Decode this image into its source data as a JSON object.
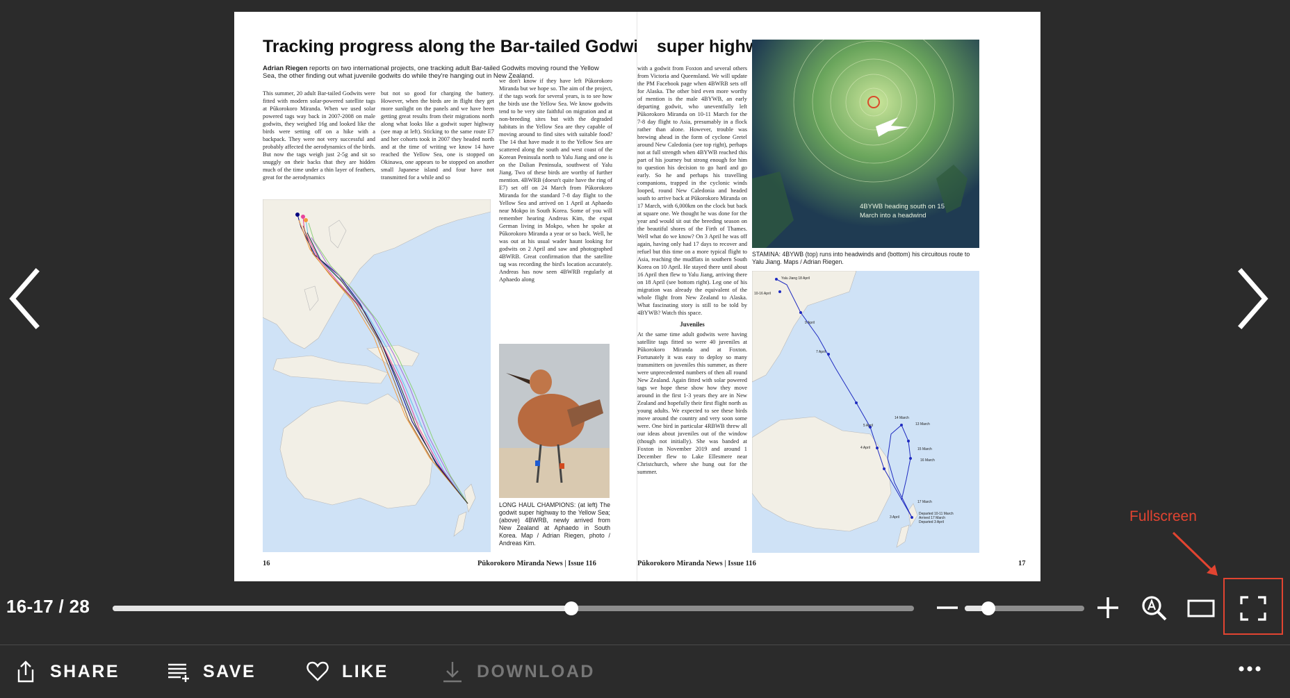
{
  "article": {
    "title_part1": "Tracking progress along the Bar-tailed Godwit",
    "title_part2": "super highway",
    "standfirst_author": "Adrian Riegen",
    "standfirst_text": " reports on two international projects, one tracking adult Bar-tailed Godwits moving round the Yellow Sea, the other finding out what juvenile godwits do while they're hanging out in New Zealand.",
    "col_l1": "This summer, 20 adult Bar-tailed Godwits were fitted with modern solar-powered satellite tags at Pūkorokoro Miranda. When we used solar powered tags way back in 2007-2008 on male godwits, they weighed 16g and looked like the birds were setting off on a hike with a backpack. They were not very successful and probably affected the aerodynamics of the birds. But now the tags weigh just 2-5g and sit so snuggly on their backs that they are hidden much of the time under a thin layer of feathers, great for the aerodynamics",
    "col_l2": "but not so good for charging the battery. However, when the birds are in flight they get more sunlight on the panels and we have been getting great results from their migrations north along what looks like a godwit super highway (see map at left). Sticking to the same route E7 and her cohorts took in 2007 they headed north and at the time of writing we know 14 have reached the Yellow Sea, one is stopped on Okinawa, one appears to be stopped on another small Japanese island and four have not transmitted for a while and so",
    "col_l3": "we don't know if they have left Pūkorokoro Miranda but we hope so. The aim of the project, if the tags work for several years, is to see how the birds use the Yellow Sea. We know godwits tend to be very site faithful on migration and at non-breeding sites but with the degraded habitats in the Yellow Sea are they capable of moving around to find sites with suitable food? The 14 that have made it to the Yellow Sea are scattered along the south and west coast of the Korean Peninsula north to Yalu Jiang and one is on the Dalian Peninsula, southwest of Yalu Jiang. Two of these birds are worthy of further mention. 4BWRB (doesn't quite have the ring of E7) set off on 24 March from Pūkorokoro Miranda for the standard 7-8 day flight to the Yellow Sea and arrived on 1 April at Aphaedo near Mokpo in South Korea. Some of you will remember hearing Andreas Kim, the expat German living in Mokpo, when he spoke at Pūkorokoro Miranda a year or so back. Well, he was out at his usual wader haunt looking for godwits on 2 April and saw and photographed 4BWRB. Great confirmation that the satellite tag was recording the bird's location accurately. Andreas has now seen 4BWRB regularly at Aphaedo along",
    "col_r1": "with a godwit from Foxton and several others from Victoria and Queensland. We will update the PM Facebook page when 4BWRB sets off for Alaska. The other bird even more worthy of mention is the male 4BYWB, an early departing godwit, who uneventfully left Pūkorokoro Miranda on 10-11 March for the 7-8 day flight to Asia, presumably in a flock rather than alone. However, trouble was brewing ahead in the form of cyclone Gretel around New Caledonia (see top right), perhaps not at full strength when 4BYWB reached this part of his journey but strong enough for him to question his decision to go hard and go early. So he and perhaps his travelling companions, trapped in the cyclonic winds looped, round New Caledonia and headed south to arrive back at Pūkorokoro Miranda on 17 March, with 6,000km on the clock but back at square one. We thought he was done for the year and would sit out the breeding season on the beautiful shores of the Firth of Thames. Well what do we know? On 3 April he was off again, having only had 17 days to recover and refuel but this time on a more typical flight to Asia, reaching the mudflats in southern South Korea on 10 April. He stayed there until about 16 April then flew to Yalu Jiang, arriving there on 18 April (see bottom right). Leg one of his migration was already the equivalent of the whole flight from New Zealand to Alaska. What fascinating story is still to be told by 4BYWB? Watch this space.",
    "juveniles_heading": "Juveniles",
    "col_r1b": "At the same time adult godwits were having satellite tags fitted so were 40 juveniles at Pūkorokoro Miranda and at Foxton. Fortunately it was easy to deploy so many transmitters on juveniles this summer, as there were unprecedented numbers of then all round New Zealand. Again fitted with solar powered tags we hope these show how they move around in the first 1-3 years they are in New Zealand and hopefully their first flight north as young adults. We expected to see these birds move around the country and very soon some were. One bird in particular 4RBWB threw all our ideas about juveniles out of the window (though not initially). She was banded at Foxton in November 2019 and around 1 December flew to Lake Ellesmere near Christchurch, where she hung out for the summer.",
    "caption_photo": "LONG HAUL CHAMPIONS: (at left) The godwit super highway to the Yellow Sea; (above) 4BWRB, newly arrived from New Zealand at Aphaedo in South Korea. Map / Adrian Riegen, photo / Andreas Kim.",
    "cyclone_label": "4BYWB heading south on 15 March into a headwind",
    "caption_cyclone": "STAMINA: 4BYWB (top) runs into headwinds and (bottom) his circuitous route to Yalu Jiang. Maps / Adrian Riegen.",
    "map_labels": [
      "Yalu Jiang 18 April",
      "10-16 April",
      "9 April",
      "7 April",
      "5 April",
      "4 April",
      "3 April",
      "14 March",
      "13 March",
      "15 March",
      "16 March",
      "17 March",
      "Departed 10-11 March",
      "Arrived 17 March",
      "Departed 3 April"
    ],
    "folio_left_num": "16",
    "folio_left_mag": "Pūkorokoro Miranda News | Issue 116",
    "folio_right_mag": "Pūkorokoro Miranda News | Issue 116",
    "folio_right_num": "17"
  },
  "annotation": {
    "label": "Fullscreen",
    "color": "#e24431"
  },
  "controls": {
    "page_counter": "16-17 / 28",
    "progress_fraction": 0.572,
    "zoom_fraction": 0.2
  },
  "actions": {
    "share": "SHARE",
    "save": "SAVE",
    "like": "LIKE",
    "download": "DOWNLOAD"
  },
  "icons": {
    "prev": "chevron-left-icon",
    "next": "chevron-right-icon",
    "zoom_out": "minus-icon",
    "zoom_in": "plus-icon",
    "magnify": "magnify-icon",
    "single_page": "single-page-icon",
    "fullscreen": "fullscreen-icon",
    "share": "share-icon",
    "save": "save-icon",
    "like": "heart-icon",
    "download": "download-icon",
    "more": "more-icon"
  },
  "colors": {
    "background": "#2b2b2b",
    "accent_annotation": "#e24431",
    "track": "#8d8d8d",
    "track_fill": "#e4e4e4"
  }
}
